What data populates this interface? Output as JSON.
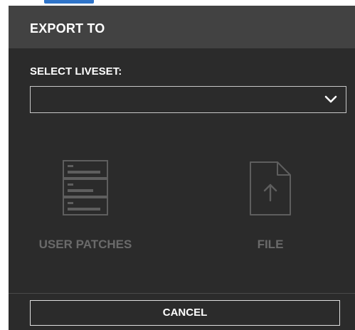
{
  "dialog": {
    "title": "EXPORT TO",
    "select_label": "SELECT LIVESET:",
    "select_value": "",
    "options": [
      {
        "label": "USER PATCHES",
        "icon": "user-patches-icon"
      },
      {
        "label": "FILE",
        "icon": "file-upload-icon"
      }
    ],
    "cancel_label": "CANCEL"
  },
  "colors": {
    "background": "#2b2b2b",
    "header": "#424242",
    "text": "#ffffff",
    "muted": "#6a6a6a",
    "border": "#c8c8c8",
    "accent": "#2f74c9"
  }
}
